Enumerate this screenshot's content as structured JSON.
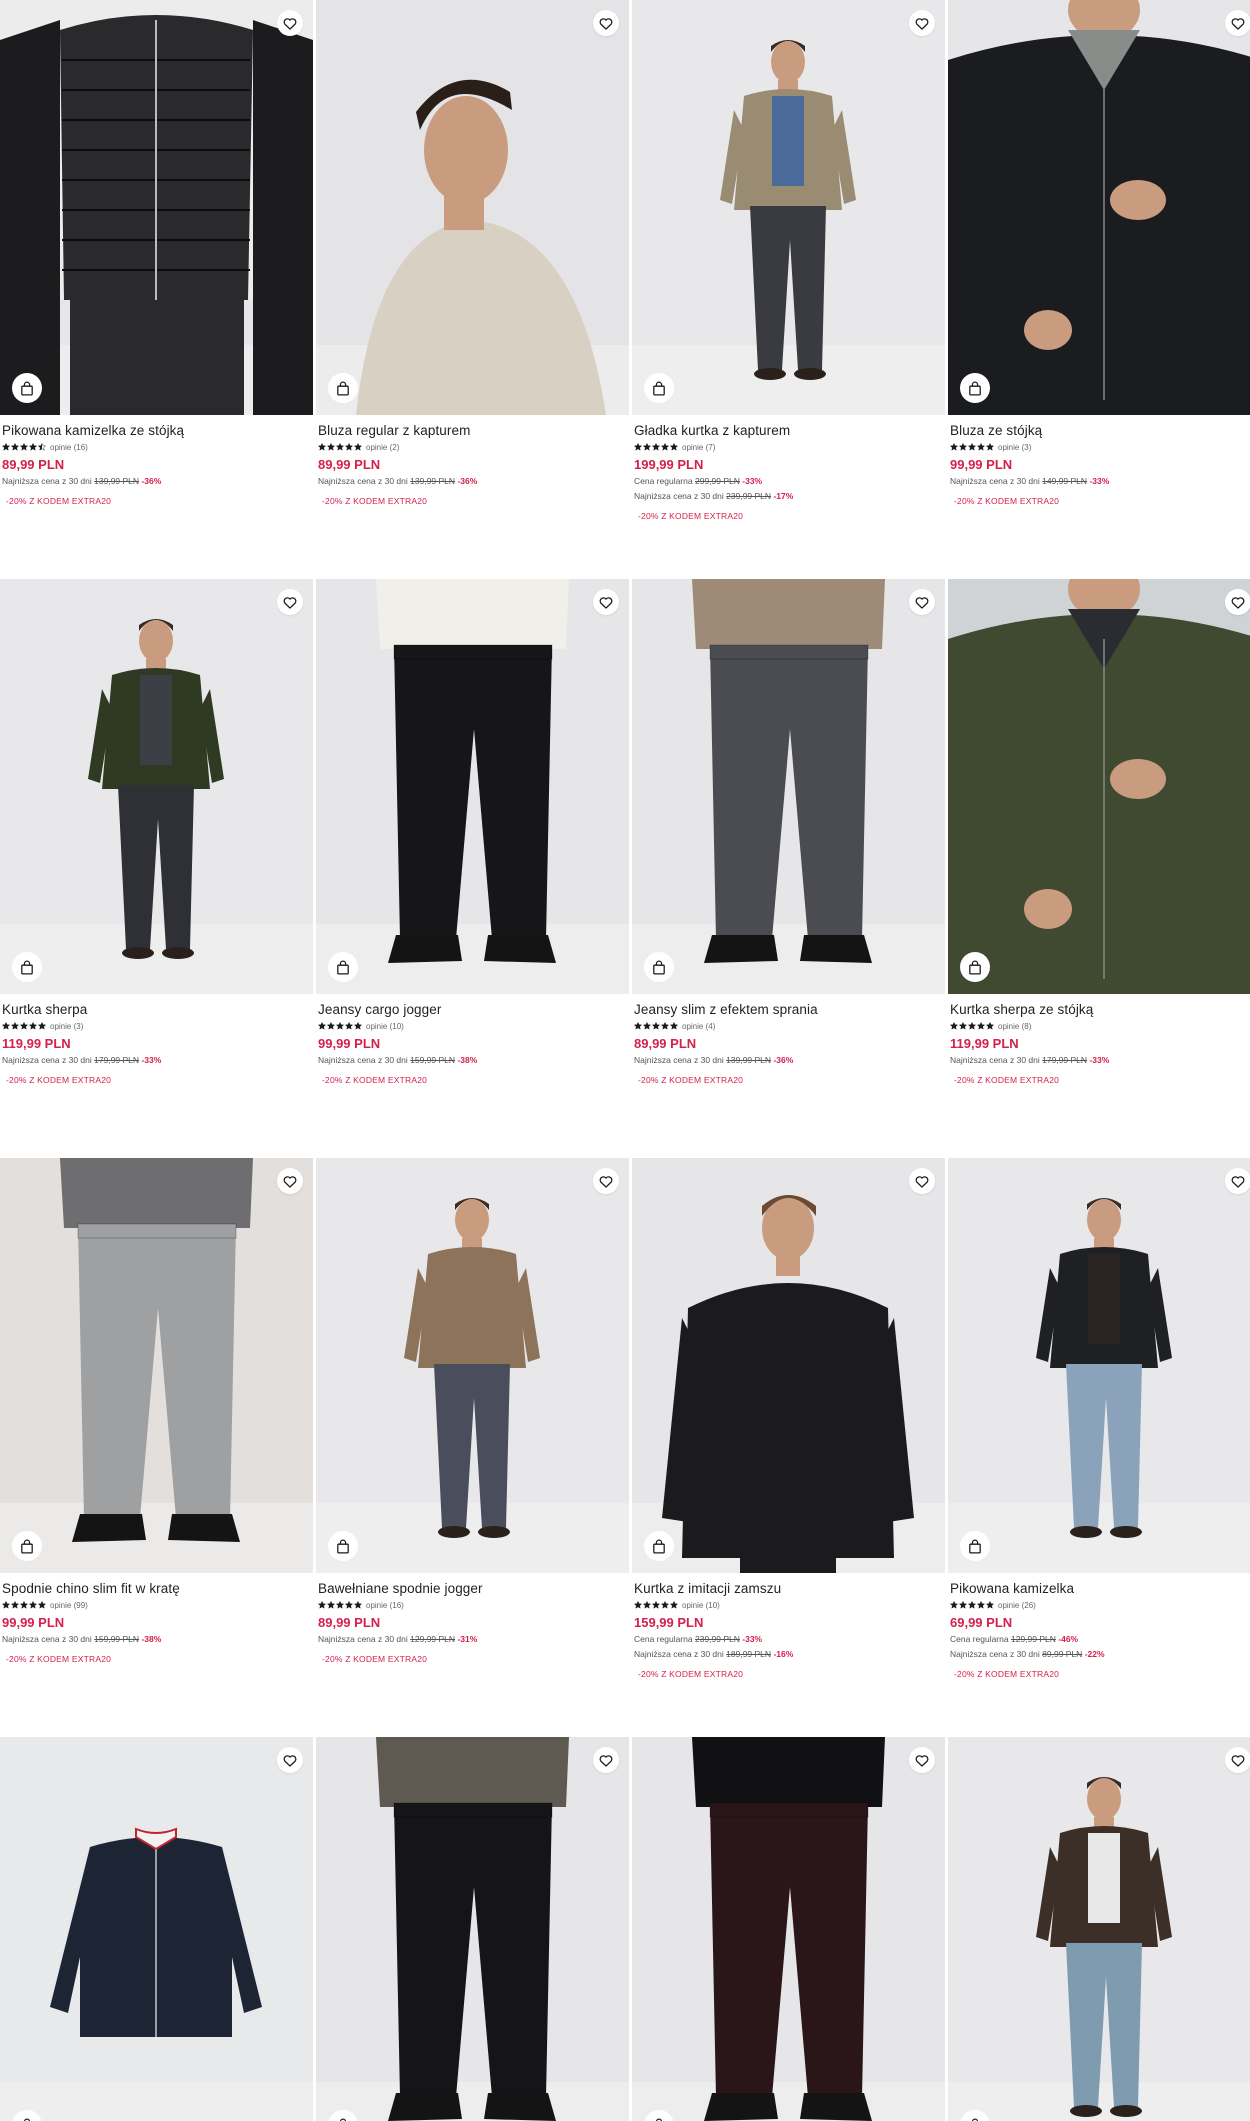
{
  "colors": {
    "price": "#d4204c",
    "text": "#222222",
    "muted": "#666666",
    "photo_bg": "#e9e9eb"
  },
  "icons": {
    "favorite": "heart-icon",
    "cart": "shopping-bag-icon",
    "star": "star-icon"
  },
  "products": [
    {
      "name": "Pikowana kamizelka ze stójką",
      "rating": 4.5,
      "reviews": "opinie (16)",
      "price": "89,99 PLN",
      "history": [
        {
          "label": "Najniższa cena z 30 dni",
          "old": "139,99 PLN",
          "discount": "-36%"
        }
      ],
      "promo": "-20% Z KODEM EXTRA20",
      "photo": {
        "bg": "#e6e6e8",
        "garment": "#1c1c1e",
        "pants": "#2a2a2e",
        "shirt": "#f2f2f2",
        "style": "closeup-vest"
      }
    },
    {
      "name": "Bluza regular z kapturem",
      "rating": 5,
      "reviews": "opinie (2)",
      "price": "89,99 PLN",
      "history": [
        {
          "label": "Najniższa cena z 30 dni",
          "old": "139,99 PLN",
          "discount": "-36%"
        }
      ],
      "promo": "-20% Z KODEM EXTRA20",
      "photo": {
        "bg": "#e4e4e6",
        "garment": "#d9d0c4",
        "pants": "#d9d0c4",
        "shirt": "#d9d0c4",
        "style": "hoodie-profile"
      }
    },
    {
      "name": "Gładka kurtka z kapturem",
      "rating": 5,
      "reviews": "opinie (7)",
      "price": "199,99 PLN",
      "history": [
        {
          "label": "Cena regularna",
          "old": "299,99 PLN",
          "discount": "-33%"
        },
        {
          "label": "Najniższa cena z 30 dni",
          "old": "239,99 PLN",
          "discount": "-17%"
        }
      ],
      "promo": "-20% Z KODEM EXTRA20",
      "photo": {
        "bg": "#e8e8ea",
        "garment": "#9a8b73",
        "pants": "#3a3b40",
        "shirt": "#4a6a9a",
        "style": "full"
      }
    },
    {
      "name": "Bluza ze stójką",
      "rating": 5,
      "reviews": "opinie (3)",
      "price": "99,99 PLN",
      "history": [
        {
          "label": "Najniższa cena z 30 dni",
          "old": "149,99 PLN",
          "discount": "-33%"
        }
      ],
      "promo": "-20% Z KODEM EXTRA20",
      "photo": {
        "bg": "#e6e6e8",
        "garment": "#1b1c20",
        "pants": "#1b1c20",
        "shirt": "#8a8c8a",
        "style": "closeup-jacket"
      }
    },
    {
      "name": "Kurtka sherpa",
      "rating": 5,
      "reviews": "opinie (3)",
      "price": "119,99 PLN",
      "history": [
        {
          "label": "Najniższa cena z 30 dni",
          "old": "179,99 PLN",
          "discount": "-33%"
        }
      ],
      "promo": "-20% Z KODEM EXTRA20",
      "photo": {
        "bg": "#e8e8ea",
        "garment": "#2f3a22",
        "pants": "#2f3036",
        "shirt": "#3b3e45",
        "style": "full"
      }
    },
    {
      "name": "Jeansy cargo jogger",
      "rating": 5,
      "reviews": "opinie (10)",
      "price": "99,99 PLN",
      "history": [
        {
          "label": "Najniższa cena z 30 dni",
          "old": "159,99 PLN",
          "discount": "-38%"
        }
      ],
      "promo": "-20% Z KODEM EXTRA20",
      "photo": {
        "bg": "#e6e6e8",
        "garment": "#f0efea",
        "pants": "#161618",
        "shirt": "#f0efea",
        "style": "pants"
      }
    },
    {
      "name": "Jeansy slim z efektem sprania",
      "rating": 5,
      "reviews": "opinie (4)",
      "price": "89,99 PLN",
      "history": [
        {
          "label": "Najniższa cena z 30 dni",
          "old": "139,99 PLN",
          "discount": "-36%"
        }
      ],
      "promo": "-20% Z KODEM EXTRA20",
      "photo": {
        "bg": "#e6e6e8",
        "garment": "#9d8b78",
        "pants": "#4a4c52",
        "shirt": "#9d8b78",
        "style": "pants"
      }
    },
    {
      "name": "Kurtka sherpa ze stójką",
      "rating": 5,
      "reviews": "opinie (8)",
      "price": "119,99 PLN",
      "history": [
        {
          "label": "Najniższa cena z 30 dni",
          "old": "179,99 PLN",
          "discount": "-33%"
        }
      ],
      "promo": "-20% Z KODEM EXTRA20",
      "photo": {
        "bg": "#cfd3d6",
        "garment": "#3f4a31",
        "pants": "#2b2c31",
        "shirt": "#2b2c31",
        "style": "closeup-jacket"
      }
    },
    {
      "name": "Spodnie chino slim fit w kratę",
      "rating": 5,
      "reviews": "opinie (99)",
      "price": "99,99 PLN",
      "history": [
        {
          "label": "Najniższa cena z 30 dni",
          "old": "159,99 PLN",
          "discount": "-38%"
        }
      ],
      "promo": "-20% Z KODEM EXTRA20",
      "photo": {
        "bg": "#e2dfdd",
        "garment": "#6e6e70",
        "pants": "#9fa0a2",
        "shirt": "#6e6e70",
        "style": "pants"
      }
    },
    {
      "name": "Bawełniane spodnie jogger",
      "rating": 5,
      "reviews": "opinie (16)",
      "price": "89,99 PLN",
      "history": [
        {
          "label": "Najniższa cena z 30 dni",
          "old": "129,99 PLN",
          "discount": "-31%"
        }
      ],
      "promo": "-20% Z KODEM EXTRA20",
      "photo": {
        "bg": "#e8e8ea",
        "garment": "#8c735a",
        "pants": "#4a4e5c",
        "shirt": "#8c735a",
        "style": "full"
      }
    },
    {
      "name": "Kurtka z imitacji zamszu",
      "rating": 5,
      "reviews": "opinie (10)",
      "price": "159,99 PLN",
      "history": [
        {
          "label": "Cena regularna",
          "old": "239,99 PLN",
          "discount": "-33%"
        },
        {
          "label": "Najniższa cena z 30 dni",
          "old": "189,99 PLN",
          "discount": "-16%"
        }
      ],
      "promo": "-20% Z KODEM EXTRA20",
      "photo": {
        "bg": "#e6e6e8",
        "garment": "#1b1b1d",
        "pants": "#1b1b1d",
        "shirt": "#1b1b1d",
        "style": "upper"
      }
    },
    {
      "name": "Pikowana kamizelka",
      "rating": 5,
      "reviews": "opinie (26)",
      "price": "69,99 PLN",
      "history": [
        {
          "label": "Cena regularna",
          "old": "129,99 PLN",
          "discount": "-46%"
        },
        {
          "label": "Najniższa cena z 30 dni",
          "old": "89,99 PLN",
          "discount": "-22%"
        }
      ],
      "promo": "-20% Z KODEM EXTRA20",
      "photo": {
        "bg": "#e8e8ea",
        "garment": "#1f2024",
        "pants": "#8aa3bb",
        "shirt": "#2a2424",
        "style": "full"
      }
    },
    {
      "name": "",
      "rating": 0,
      "reviews": "",
      "price": "",
      "history": [],
      "promo": "",
      "photo": {
        "bg": "#e8e9eb",
        "garment": "#1d2535",
        "pants": "#1d2535",
        "shirt": "#1d2535",
        "style": "flat-jacket"
      }
    },
    {
      "name": "",
      "rating": 0,
      "reviews": "",
      "price": "",
      "history": [],
      "promo": "",
      "photo": {
        "bg": "#e6e6e8",
        "garment": "#5e5a52",
        "pants": "#151517",
        "shirt": "#3a302c",
        "style": "pants"
      }
    },
    {
      "name": "",
      "rating": 0,
      "reviews": "",
      "price": "",
      "history": [],
      "promo": "",
      "photo": {
        "bg": "#e6e6e8",
        "garment": "#111113",
        "pants": "#2a1519",
        "shirt": "#111113",
        "style": "pants"
      }
    },
    {
      "name": "",
      "rating": 0,
      "reviews": "",
      "price": "",
      "history": [],
      "promo": "",
      "photo": {
        "bg": "#e8e8ea",
        "garment": "#3b2f28",
        "pants": "#7f9bb0",
        "shirt": "#e8e8e8",
        "style": "full"
      }
    }
  ]
}
